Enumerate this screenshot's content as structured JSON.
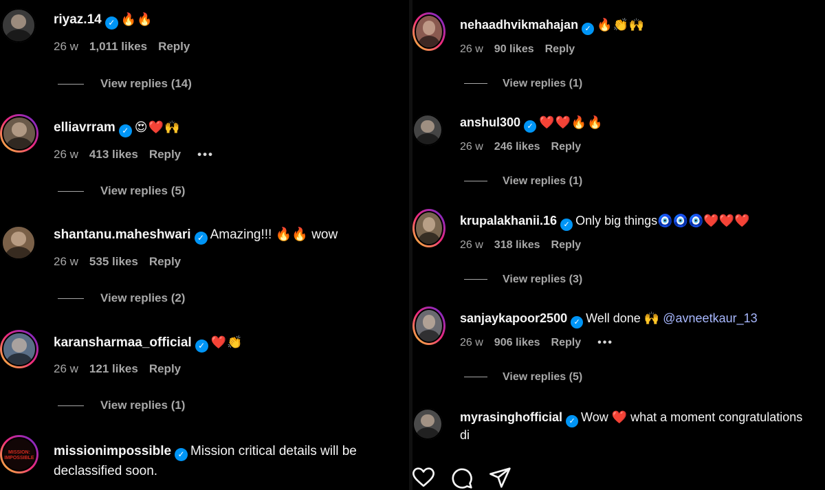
{
  "left_comments": [
    {
      "username": "riyaz.14",
      "text": "🔥🔥",
      "time": "26 w",
      "likes": "1,011 likes",
      "reply": "Reply",
      "view_replies": "View replies (14)"
    },
    {
      "username": "elliavrram",
      "text": "😍❤️🙌",
      "time": "26 w",
      "likes": "413 likes",
      "reply": "Reply",
      "more": "•••",
      "view_replies": "View replies (5)"
    },
    {
      "username": "shantanu.maheshwari",
      "text": "Amazing!!! 🔥🔥 wow",
      "time": "26 w",
      "likes": "535 likes",
      "reply": "Reply",
      "view_replies": "View replies (2)"
    },
    {
      "username": "karansharmaa_official",
      "text": "❤️👏",
      "time": "26 w",
      "likes": "121 likes",
      "reply": "Reply",
      "view_replies": "View replies (1)"
    },
    {
      "username": "missionimpossible",
      "text": "Mission critical details will be declassified soon.",
      "avatar_text": "MISSION: IMPOSSIBLE"
    }
  ],
  "right_comments": [
    {
      "username": "nehaadhvikmahajan",
      "text": "🔥👏🙌",
      "time": "26 w",
      "likes": "90 likes",
      "reply": "Reply",
      "view_replies": "View replies (1)"
    },
    {
      "username": "anshul300",
      "text": "❤️❤️🔥🔥",
      "time": "26 w",
      "likes": "246 likes",
      "reply": "Reply",
      "view_replies": "View replies (1)"
    },
    {
      "username": "krupalakhanii.16",
      "text": "Only big things🧿🧿🧿❤️❤️❤️",
      "time": "26 w",
      "likes": "318 likes",
      "reply": "Reply",
      "view_replies": "View replies (3)"
    },
    {
      "username": "sanjaykapoor2500",
      "text": "Well done 🙌",
      "mention": "@avneetkaur_13",
      "time": "26 w",
      "likes": "906 likes",
      "reply": "Reply",
      "more": "•••",
      "view_replies": "View replies (5)"
    },
    {
      "username": "myrasinghofficial",
      "text": "Wow ❤️ what a moment congratulations",
      "text_cont": "di"
    }
  ],
  "icons": {
    "verified": "verified-badge-icon",
    "like": "heart-icon",
    "comment": "comment-icon",
    "share": "send-icon"
  },
  "colors": {
    "background": "#000000",
    "verified": "#0095f6",
    "muted": "#a8a8a8",
    "mention": "#a8b8ff"
  }
}
